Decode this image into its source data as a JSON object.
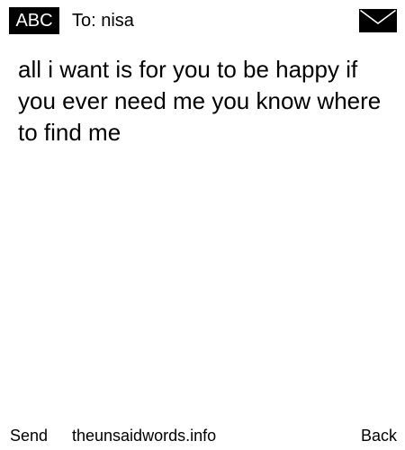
{
  "header": {
    "input_mode_label": "ABC",
    "recipient_label": "To: nisa",
    "envelope_icon": "envelope-icon"
  },
  "message": {
    "body": "all i want is for you to be happy if you ever need me you know where to find me"
  },
  "footer": {
    "send_label": "Send",
    "site_label": "theunsaidwords.info",
    "back_label": "Back"
  },
  "colors": {
    "background": "#ffffff",
    "text": "#000000",
    "badge_background": "#000000",
    "badge_text": "#ffffff"
  }
}
